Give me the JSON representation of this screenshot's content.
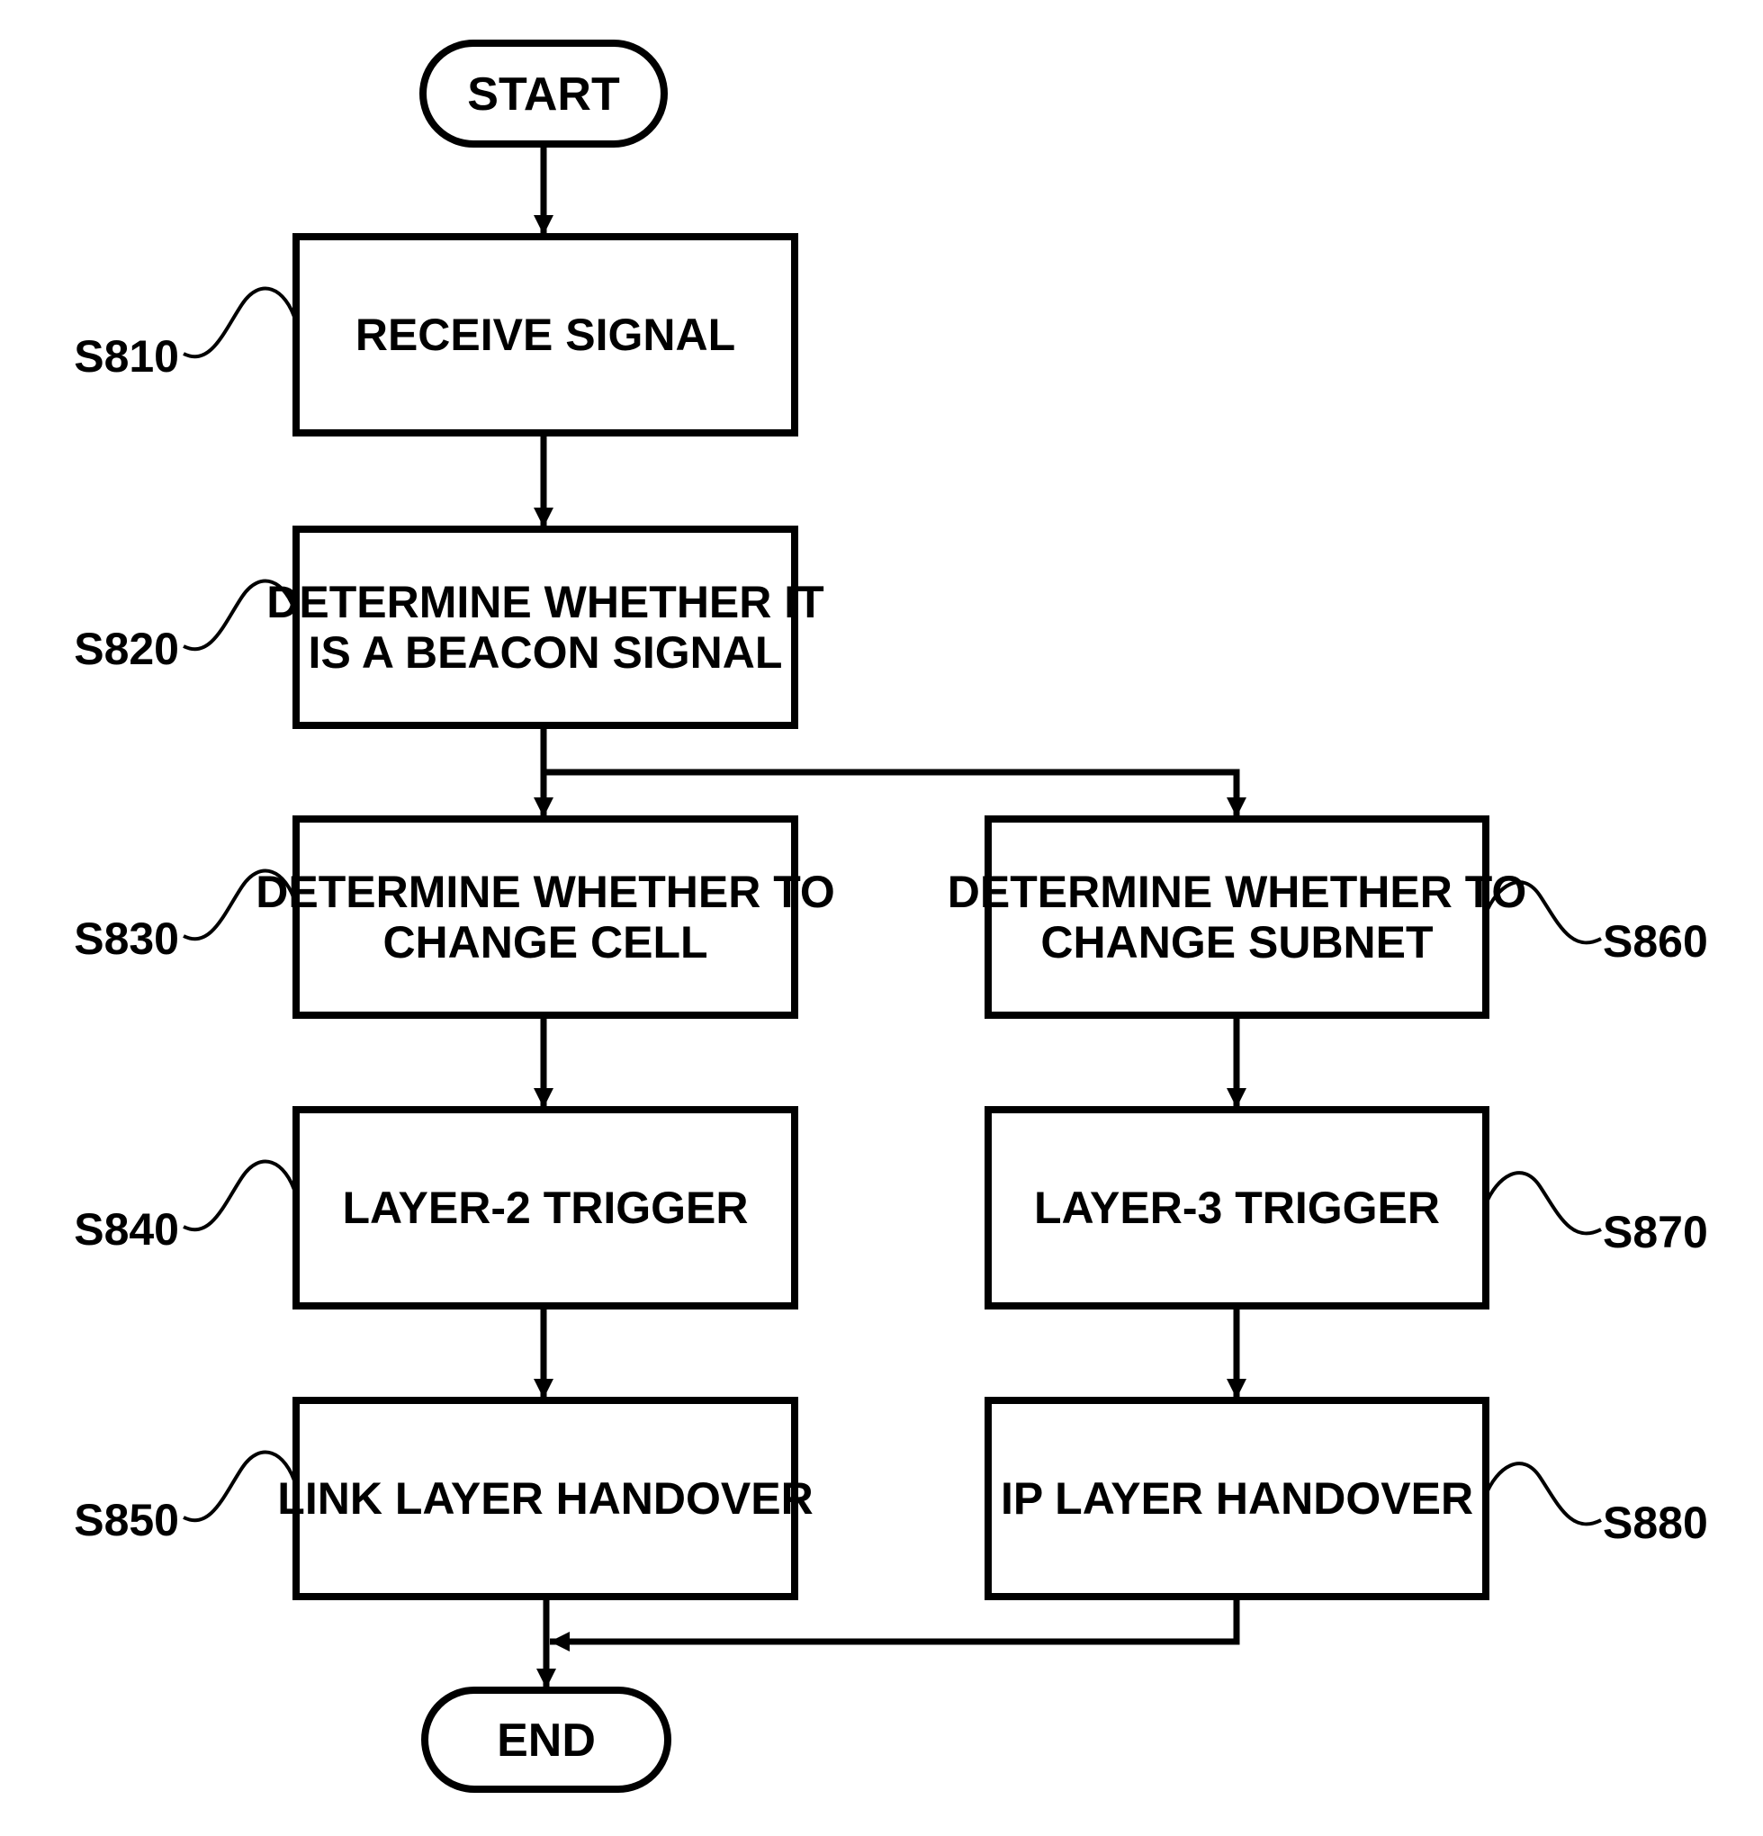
{
  "diagram": {
    "type": "flowchart",
    "colors": {
      "stroke": "#000000",
      "background": "#ffffff",
      "text": "#000000"
    },
    "start": {
      "label": "START"
    },
    "end": {
      "label": "END"
    },
    "steps": [
      {
        "id": "S810",
        "lines": [
          "RECEIVE SIGNAL"
        ]
      },
      {
        "id": "S820",
        "lines": [
          "DETERMINE WHETHER IT",
          "IS A BEACON SIGNAL"
        ]
      },
      {
        "id": "S830",
        "lines": [
          "DETERMINE WHETHER TO",
          "CHANGE CELL"
        ]
      },
      {
        "id": "S840",
        "lines": [
          "LAYER-2 TRIGGER"
        ]
      },
      {
        "id": "S850",
        "lines": [
          "LINK LAYER HANDOVER"
        ]
      },
      {
        "id": "S860",
        "lines": [
          "DETERMINE WHETHER TO",
          "CHANGE SUBNET"
        ]
      },
      {
        "id": "S870",
        "lines": [
          "LAYER-3 TRIGGER"
        ]
      },
      {
        "id": "S880",
        "lines": [
          "IP LAYER HANDOVER"
        ]
      }
    ],
    "edges": [
      {
        "from": "START",
        "to": "S810"
      },
      {
        "from": "S810",
        "to": "S820"
      },
      {
        "from": "S820",
        "to": "S830"
      },
      {
        "from": "S820",
        "to": "S860"
      },
      {
        "from": "S830",
        "to": "S840"
      },
      {
        "from": "S840",
        "to": "S850"
      },
      {
        "from": "S860",
        "to": "S870"
      },
      {
        "from": "S870",
        "to": "S880"
      },
      {
        "from": "S850",
        "to": "END"
      },
      {
        "from": "S880",
        "to": "END"
      }
    ]
  }
}
